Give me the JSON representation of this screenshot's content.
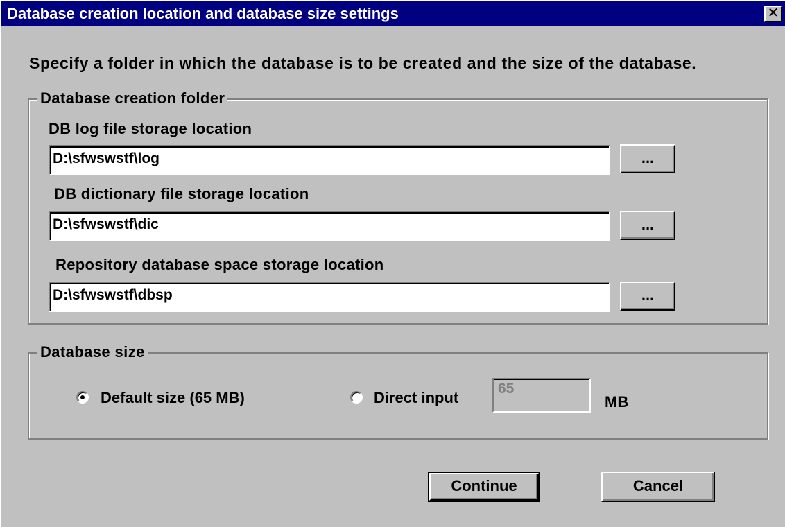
{
  "window": {
    "title": "Database creation location and database size settings",
    "close_glyph": "✕"
  },
  "instruction": "Specify a folder in which the database is to be created and the size of the database.",
  "creation_folder": {
    "group_label": "Database creation folder",
    "fields": [
      {
        "label": "DB log file storage location",
        "value": "D:\\sfwswstf\\log",
        "browse_label": "..."
      },
      {
        "label": "DB dictionary file storage location",
        "value": "D:\\sfwswstf\\dic",
        "browse_label": "..."
      },
      {
        "label": "Repository database space storage location",
        "value": "D:\\sfwswstf\\dbsp",
        "browse_label": "..."
      }
    ]
  },
  "database_size": {
    "group_label": "Database size",
    "default_option": {
      "label": "Default size (65 MB)",
      "selected": true
    },
    "direct_option": {
      "label": "Direct input",
      "selected": false
    },
    "direct_value": "65",
    "unit": "MB"
  },
  "buttons": {
    "continue_label": "Continue",
    "cancel_label": "Cancel"
  }
}
